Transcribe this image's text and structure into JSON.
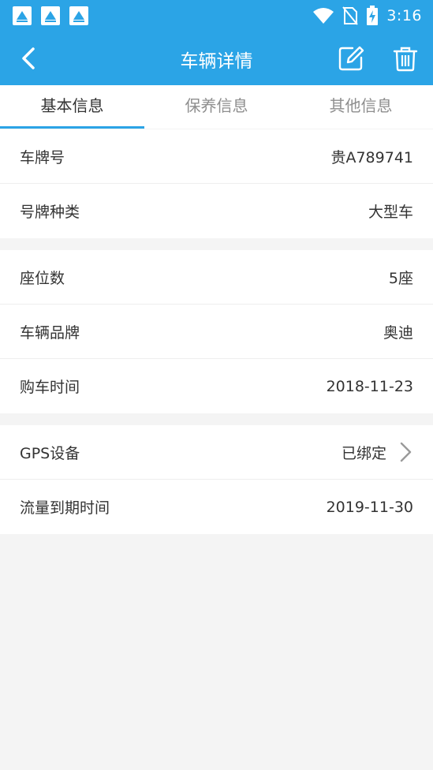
{
  "status_bar": {
    "time": "3:16",
    "notification_icons": [
      "app-notification-icon",
      "app-notification-icon",
      "app-notification-icon"
    ],
    "icons": [
      "wifi-icon",
      "no-sim-icon",
      "battery-charging-icon"
    ]
  },
  "toolbar": {
    "title": "车辆详情",
    "back_icon": "chevron-left-icon",
    "edit_icon": "edit-icon",
    "delete_icon": "trash-icon",
    "color": "#2ba4e6"
  },
  "tabs": [
    {
      "label": "基本信息",
      "active": true
    },
    {
      "label": "保养信息",
      "active": false
    },
    {
      "label": "其他信息",
      "active": false
    }
  ],
  "groups": [
    {
      "rows": [
        {
          "label": "车牌号",
          "value": "贵A789741"
        },
        {
          "label": "号牌种类",
          "value": "大型车"
        }
      ]
    },
    {
      "rows": [
        {
          "label": "座位数",
          "value": "5座"
        },
        {
          "label": "车辆品牌",
          "value": "奥迪"
        },
        {
          "label": "购车时间",
          "value": "2018-11-23"
        }
      ]
    },
    {
      "rows": [
        {
          "label": "GPS设备",
          "value": "已绑定",
          "has_arrow": true
        },
        {
          "label": "流量到期时间",
          "value": "2019-11-30"
        }
      ]
    }
  ]
}
